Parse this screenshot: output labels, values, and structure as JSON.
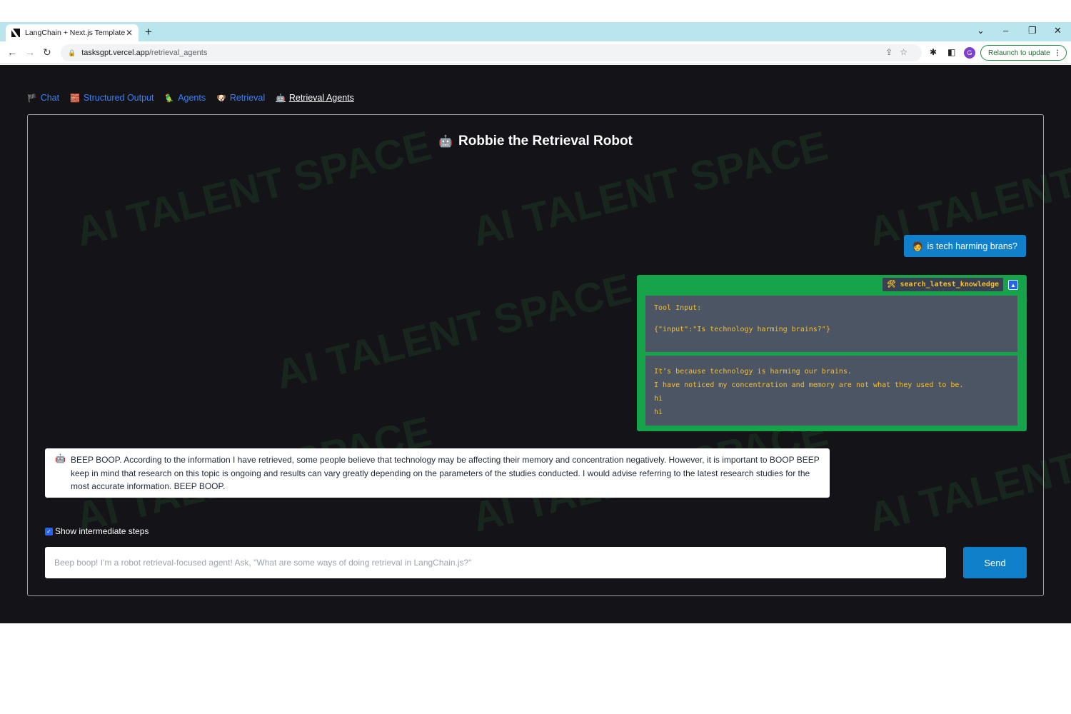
{
  "browser": {
    "tab_title": "LangChain + Next.js Template",
    "tab_close": "✕",
    "new_tab": "+",
    "url_host": "tasksgpt.vercel.app",
    "url_path": "/retrieval_agents",
    "relaunch_label": "Relaunch to update",
    "profile_initial": "G"
  },
  "nav": {
    "items": [
      {
        "emoji": "🏴",
        "label": "Chat"
      },
      {
        "emoji": "🧱",
        "label": "Structured Output"
      },
      {
        "emoji": "🦜",
        "label": "Agents"
      },
      {
        "emoji": "🐶",
        "label": "Retrieval"
      },
      {
        "emoji": "🤖",
        "label": "Retrieval Agents"
      }
    ],
    "active": "Retrieval Agents"
  },
  "chat": {
    "title_emoji": "🤖",
    "title": "Robbie the Retrieval Robot",
    "user_emoji": "🧑",
    "user_message": "is tech harming brans?",
    "tool": {
      "icon": "🛠",
      "name": "search_latest_knowledge",
      "input_label": "Tool Input:",
      "input_value": "{\"input\":\"Is technology harming brains?\"}",
      "output_lines": [
        "It’s because technology is harming our brains.",
        "I have noticed my concentration and memory are not what they used to be.",
        "hi",
        "hi"
      ]
    },
    "bot_emoji": "🤖",
    "bot_message": "BEEP BOOP. According to the information I have retrieved, some people believe that technology may be affecting their memory and concentration negatively. However, it is important to BOOP BEEP keep in mind that research on this topic is ongoing and results can vary greatly depending on the parameters of the studies conducted. I would advise referring to the latest research studies for the most accurate information. BEEP BOOP.",
    "show_steps_label": "Show intermediate steps",
    "show_steps_checked": true,
    "input_placeholder": "Beep boop! I'm a robot retrieval-focused agent! Ask, \"What are some ways of doing retrieval in LangChain.js?\"",
    "send_label": "Send"
  },
  "watermark": "AI TALENT SPACE",
  "colors": {
    "page_bg": "#131318",
    "accent_blue": "#0f80c9",
    "tool_green": "#16a34a",
    "tool_text": "#fbbf24"
  }
}
